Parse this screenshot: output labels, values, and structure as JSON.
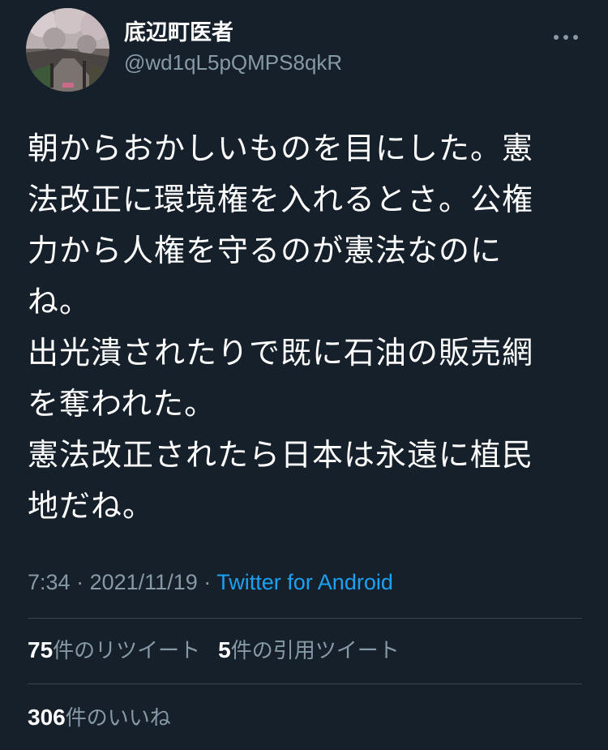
{
  "user": {
    "display_name": "底辺町医者",
    "handle": "@wd1qL5pQMPS8qkR"
  },
  "tweet": {
    "text": "朝からおかしいものを目にした。憲\n法改正に環境権を入れるとさ。公権\n力から人権を守るのが憲法なのに\nね。\n出光潰されたりで既に石油の販売網\nを奪われた。\n憲法改正されたら日本は永遠に植民\n地だね。",
    "time": "7:34",
    "separator": "·",
    "date": "2021/11/19",
    "source": "Twitter for Android"
  },
  "stats": {
    "retweets_count": "75",
    "retweets_label": "件のリツイート",
    "quotes_count": "5",
    "quotes_label": "件の引用ツイート",
    "likes_count": "306",
    "likes_label": "件のいいね"
  },
  "icons": {
    "more": "more-horizontal-icon",
    "avatar": "cherry-blossom-photo"
  },
  "colors": {
    "background": "#15202b",
    "secondary_text": "#8899a6",
    "link": "#1da1f2",
    "divider": "#38444d"
  }
}
